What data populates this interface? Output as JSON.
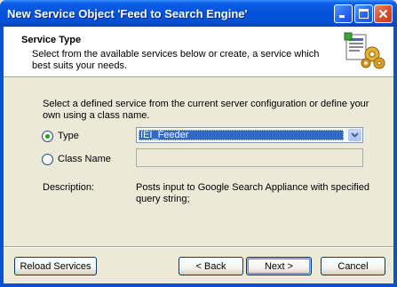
{
  "window": {
    "title": "New Service Object 'Feed to Search Engine'"
  },
  "header": {
    "title": "Service Type",
    "subtitle": "Select from the available services below or create, a service which best suits your needs."
  },
  "form": {
    "intro": "Select a defined service from the current server configuration or define your own using a class name.",
    "type_label": "Type",
    "type_value": "IEI_Feeder",
    "class_name_label": "Class Name",
    "class_name_value": "",
    "description_label": "Description:",
    "description_text": "Posts input to Google Search Appliance with specified query string;"
  },
  "buttons": {
    "reload": "Reload Services",
    "back": "< Back",
    "next": "Next >",
    "cancel": "Cancel"
  }
}
